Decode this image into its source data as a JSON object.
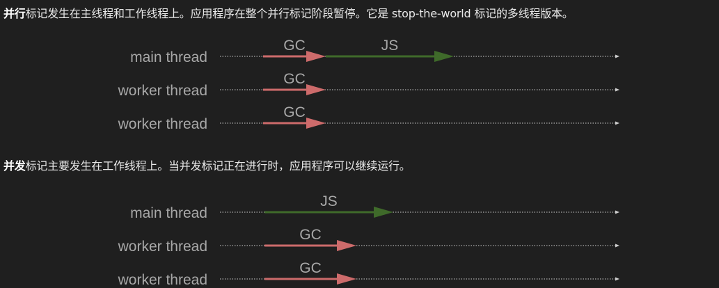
{
  "parallel": {
    "bold": "并行",
    "text": "标记发生在主线程和工作线程上。应用程序在整个并行标记阶段暂停。它是 stop-the-world 标记的多线程版本。",
    "rows": [
      {
        "thread": "main thread",
        "segments": [
          {
            "label": "GC",
            "kind": "gc"
          },
          {
            "label": "JS",
            "kind": "js"
          }
        ]
      },
      {
        "thread": "worker thread",
        "segments": [
          {
            "label": "GC",
            "kind": "gc"
          }
        ]
      },
      {
        "thread": "worker thread",
        "segments": [
          {
            "label": "GC",
            "kind": "gc"
          }
        ]
      }
    ]
  },
  "concurrent": {
    "bold": "并发",
    "text": "标记主要发生在工作线程上。当并发标记正在进行时，应用程序可以继续运行。",
    "rows": [
      {
        "thread": "main thread",
        "segments": [
          {
            "label": "JS",
            "kind": "js"
          }
        ]
      },
      {
        "thread": "worker thread",
        "segments": [
          {
            "label": "GC",
            "kind": "gc"
          }
        ]
      },
      {
        "thread": "worker thread",
        "segments": [
          {
            "label": "GC",
            "kind": "gc"
          }
        ]
      }
    ]
  },
  "colors": {
    "gc": "#cd6b6b",
    "js": "#3f6a2a",
    "timeline": "#cfcfcf",
    "background": "#1f1f1f"
  }
}
